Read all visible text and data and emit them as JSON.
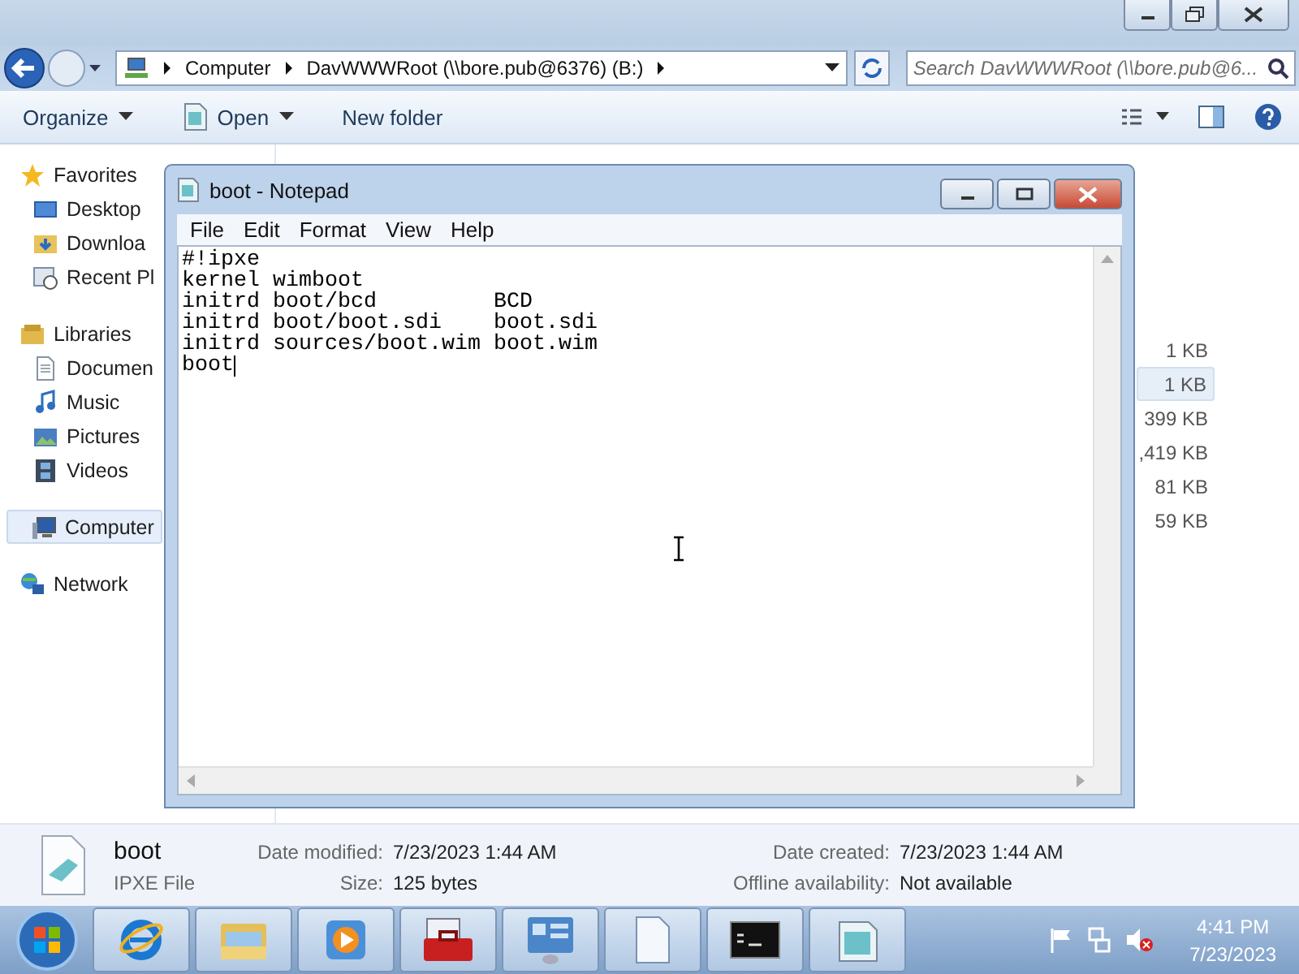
{
  "explorer": {
    "address": {
      "segments": [
        "Computer",
        "DavWWWRoot (\\\\bore.pub@6376) (B:)"
      ]
    },
    "search": {
      "placeholder": "Search DavWWWRoot (\\\\bore.pub@6..."
    },
    "toolbar": [
      {
        "label": "Organize",
        "kind": "menu"
      },
      {
        "label": "Open",
        "kind": "open"
      },
      {
        "label": "New folder",
        "kind": "plain"
      }
    ],
    "sidebar": [
      {
        "label": "Favorites",
        "selected": false,
        "children": [
          {
            "label": "Desktop",
            "selected": false
          },
          {
            "label": "Downloa",
            "selected": false
          },
          {
            "label": "Recent Pl",
            "selected": false
          }
        ]
      },
      {
        "label": "Libraries",
        "selected": false,
        "children": [
          {
            "label": "Documen",
            "selected": false
          },
          {
            "label": "Music",
            "selected": false
          },
          {
            "label": "Pictures",
            "selected": false
          },
          {
            "label": "Videos",
            "selected": false
          }
        ]
      },
      {
        "label": "Computer",
        "selected": true
      },
      {
        "label": "Network",
        "selected": false
      }
    ],
    "files": [
      {
        "size": "1 KB",
        "selected": false
      },
      {
        "size": "1 KB",
        "selected": true
      },
      {
        "size": "399 KB",
        "selected": false
      },
      {
        "size": ",419 KB",
        "selected": false
      },
      {
        "size": "81 KB",
        "selected": false
      },
      {
        "size": "59 KB",
        "selected": false
      }
    ],
    "details": {
      "name": "boot",
      "type": "IPXE File",
      "fields": [
        {
          "label": "Date modified:",
          "value": "7/23/2023 1:44 AM"
        },
        {
          "label": "Date created:",
          "value": "7/23/2023 1:44 AM"
        },
        {
          "label": "Size:",
          "value": "125 bytes"
        },
        {
          "label": "Offline availability:",
          "value": "Not available"
        }
      ]
    }
  },
  "notepad": {
    "title": "boot - Notepad",
    "menu": [
      "File",
      "Edit",
      "Format",
      "View",
      "Help"
    ],
    "lines": [
      "#!ipxe",
      "kernel wimboot",
      "initrd boot/bcd         BCD",
      "initrd boot/boot.sdi    boot.sdi",
      "initrd sources/boot.wim boot.wim",
      "boot"
    ]
  },
  "taskbar": {
    "apps": [
      {
        "kind": "ie"
      },
      {
        "kind": "explorer"
      },
      {
        "kind": "media"
      },
      {
        "kind": "toolbox"
      },
      {
        "kind": "control"
      },
      {
        "kind": "document"
      },
      {
        "kind": "cmd"
      },
      {
        "kind": "notepad"
      }
    ],
    "time": "4:41 PM",
    "date": "7/23/2023"
  }
}
